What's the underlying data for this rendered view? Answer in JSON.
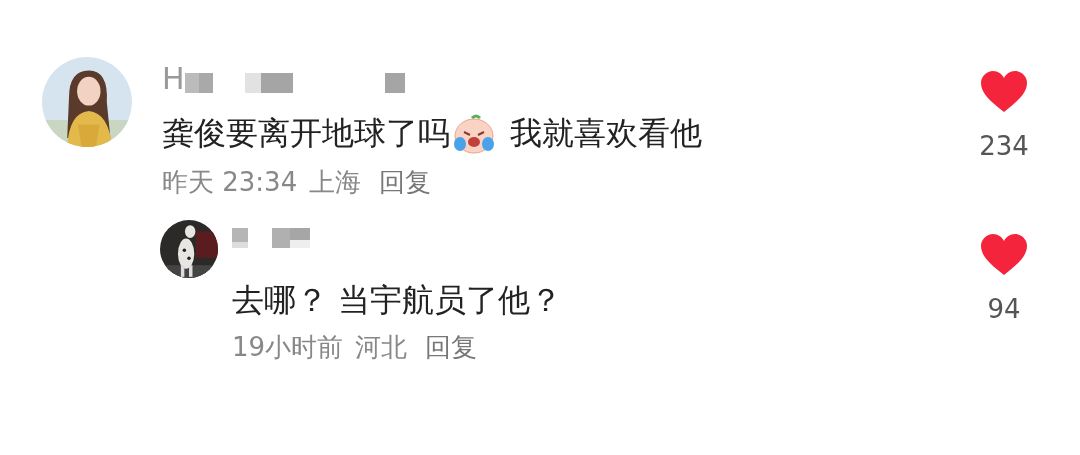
{
  "comments": [
    {
      "username": "H",
      "parts": [
        {
          "kind": "text",
          "text": "龚俊要离开地球了吗"
        },
        {
          "kind": "emoji"
        },
        {
          "kind": "text",
          "text": "我就喜欢看他"
        }
      ],
      "time": "昨天 23:34",
      "location": "上海",
      "reply_label": "回复",
      "liked": true,
      "like_count": "234",
      "replies": [
        {
          "parts": [
            {
              "kind": "text",
              "text": "去哪？ 当宇航员了他？"
            }
          ],
          "time": "19小时前",
          "location": "河北",
          "reply_label": "回复",
          "liked": true,
          "like_count": "94"
        }
      ]
    }
  ]
}
